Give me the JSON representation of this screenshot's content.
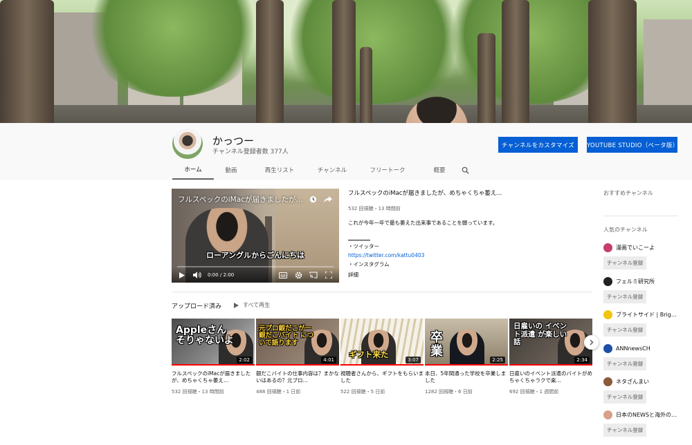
{
  "channel": {
    "name": "かっつー",
    "subscribers": "チャンネル登録者数 377人",
    "customize_label": "チャンネルをカスタマイズ",
    "studio_label": "YOUTUBE STUDIO（ベータ版）"
  },
  "tabs": [
    "ホーム",
    "動画",
    "再生リスト",
    "チャンネル",
    "フリートーク",
    "概要"
  ],
  "active_tab": "ホーム",
  "featured": {
    "player_title": "フルスペックのiMacが届きましたが、めちゃくちゃ萎えています。",
    "caption": "ローアングルからごんにちは",
    "time": "0:00 / 2:00",
    "title": "フルスペックのiMacが届きましたが、めちゃくちゃ萎えています。",
    "meta": "532 回視聴・13 時間前",
    "description": "これが今年一年で最も萎えた出来事であることを願っています。",
    "twitter_label": "・ツイッター",
    "twitter_url": "https://twitter.com/kattu0403",
    "instagram_label": "・インスタグラム",
    "more": "詳細"
  },
  "uploads": {
    "title": "アップロード済み",
    "play_all": "すべて再生",
    "videos": [
      {
        "thumb_text": "Appleさん そりゃないよ",
        "duration": "2:02",
        "title": "フルスペックのiMacが届きましたが、めちゃくちゃ萎え…",
        "meta": "532 回視聴・13 時間前"
      },
      {
        "thumb_text": "元プロ銀だこが一 銀だこバイト について語ります",
        "duration": "4:01",
        "title": "銀だこバイトの仕事内容は？まかないはあるの？元プロ…",
        "meta": "488 回視聴・1 日前"
      },
      {
        "thumb_text": "ギフト来た",
        "duration": "3:07",
        "title": "視聴者さんから、ギフトをもらいました",
        "meta": "522 回視聴・5 日前"
      },
      {
        "thumb_text": "卒 業",
        "duration": "2:25",
        "title": "本日、5年間通った学校を卒業しました",
        "meta": "1282 回視聴・6 日前"
      },
      {
        "thumb_text": "日雇いの イベント派遣 が楽しい話",
        "duration": "2:34",
        "title": "日雇いのイベント派遣のバイトがめちゃくちゃラクで楽…",
        "meta": "692 回視聴・1 週間前"
      }
    ]
  },
  "sidebar": {
    "recommended_title": "おすすめチャンネル",
    "popular_title": "人気のチャンネル",
    "subscribe_label": "チャンネル登録",
    "channels": [
      {
        "name": "漫画でいこーよ",
        "color": "#c43d6b"
      },
      {
        "name": "フェルミ研究所",
        "color": "#222222"
      },
      {
        "name": "ブライトサイド | Bright Side Japan",
        "color": "#f2c40f"
      },
      {
        "name": "ANNnewsCH",
        "color": "#1e4fa8"
      },
      {
        "name": "ネタざんまい",
        "color": "#8a5a3a"
      },
      {
        "name": "日本のNEWSと海外の反応",
        "color": "#d9a08a"
      }
    ]
  },
  "colors": {
    "accent": "#065fd4",
    "progress": "#ff0000"
  }
}
